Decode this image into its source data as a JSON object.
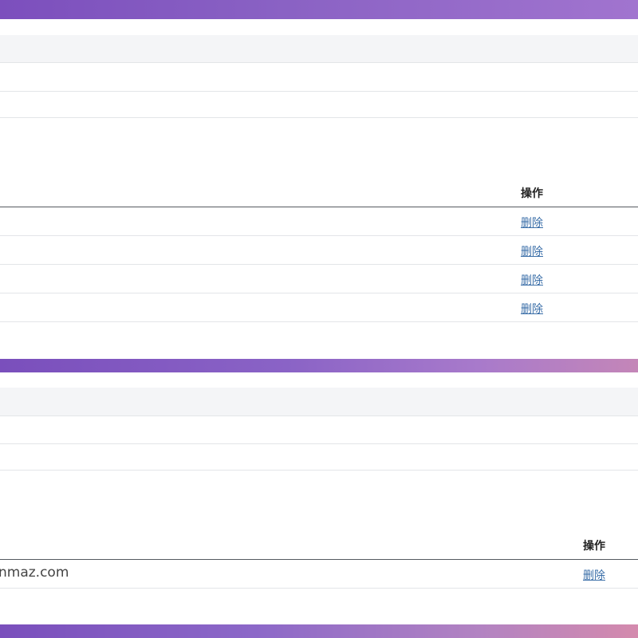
{
  "section1": {
    "list": {
      "action_header": "操作",
      "rows": [
        {
          "text": "",
          "action": "删除"
        },
        {
          "text": "",
          "action": "删除"
        },
        {
          "text": "",
          "action": "删除"
        },
        {
          "text": "",
          "action": "删除"
        }
      ]
    }
  },
  "section2": {
    "list": {
      "action_header": "操作",
      "rows": [
        {
          "text": "nmaz.com",
          "action": "删除"
        }
      ]
    }
  },
  "colors": {
    "band_start": "#7c4fbd",
    "band_end": "#d48aad",
    "link": "#3a6ea8",
    "header_bg": "#f4f5f7"
  }
}
